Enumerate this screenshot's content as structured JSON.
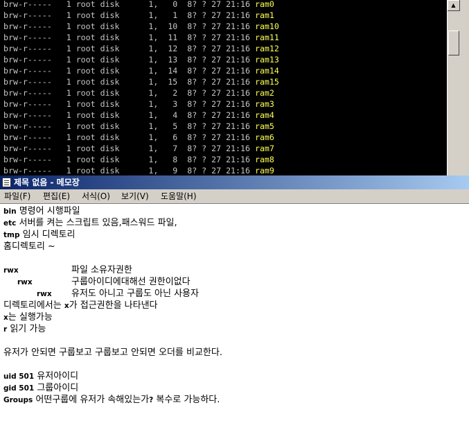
{
  "terminal": {
    "lines": [
      {
        "text": "brw-r-----   1 root disk      1,   0  8? ? 27 21:16 ",
        "file": "ram0"
      },
      {
        "text": "brw-r-----   1 root disk      1,   1  8? ? 27 21:16 ",
        "file": "ram1"
      },
      {
        "text": "brw-r-----   1 root disk      1,  10  8? ? 27 21:16 ",
        "file": "ram10"
      },
      {
        "text": "brw-r-----   1 root disk      1,  11  8? ? 27 21:16 ",
        "file": "ram11"
      },
      {
        "text": "brw-r-----   1 root disk      1,  12  8? ? 27 21:16 ",
        "file": "ram12"
      },
      {
        "text": "brw-r-----   1 root disk      1,  13  8? ? 27 21:16 ",
        "file": "ram13"
      },
      {
        "text": "brw-r-----   1 root disk      1,  14  8? ? 27 21:16 ",
        "file": "ram14"
      },
      {
        "text": "brw-r-----   1 root disk      1,  15  8? ? 27 21:16 ",
        "file": "ram15"
      },
      {
        "text": "brw-r-----   1 root disk      1,   2  8? ? 27 21:16 ",
        "file": "ram2"
      },
      {
        "text": "brw-r-----   1 root disk      1,   3  8? ? 27 21:16 ",
        "file": "ram3"
      },
      {
        "text": "brw-r-----   1 root disk      1,   4  8? ? 27 21:16 ",
        "file": "ram4"
      },
      {
        "text": "brw-r-----   1 root disk      1,   5  8? ? 27 21:16 ",
        "file": "ram5"
      },
      {
        "text": "brw-r-----   1 root disk      1,   6  8? ? 27 21:16 ",
        "file": "ram6"
      },
      {
        "text": "brw-r-----   1 root disk      1,   7  8? ? 27 21:16 ",
        "file": "ram7"
      },
      {
        "text": "brw-r-----   1 root disk      1,   8  8? ? 27 21:16 ",
        "file": "ram8"
      },
      {
        "text": "brw-r-----   1 root disk      1,   9  8? ? 27 21:16 ",
        "file": "ram9"
      }
    ]
  },
  "notepad": {
    "title": "제목 없음 - 메모장",
    "menu": [
      "파일(F)",
      "편집(E)",
      "서식(O)",
      "보기(V)",
      "도움말(H)"
    ],
    "lines": {
      "l1_key": "bin",
      "l1_text": " 명령어 시행파일",
      "l2_key": "etc",
      "l2_text": " 서버를 켜는 스크립트 있음,패스워드 파일,",
      "l3_key": "tmp",
      "l3_text": " 임시 디렉토리",
      "l4_text": "홈디렉토리 ~",
      "rwx1_key": "rwx",
      "rwx1_text": "파일 소유자권한",
      "rwx2_key": "rwx",
      "rwx2_text": "구룹아이디에대해선 권한이없다",
      "rwx3_key": "rwx",
      "rwx3_text": "유저도 아니고 구룹도 아닌 사용자",
      "l8_pre": "디렉토리에서는 ",
      "l8_key": "x",
      "l8_post": "가 접근권한을 나타낸다",
      "l9_key": "x",
      "l9_text": "는 실행가능",
      "l10_key": "r",
      "l10_text": " 읽기 가능",
      "l11_text": "유저가 안되면 구룹보고 구룹보고 안되면 오더를 비교한다.",
      "l12_key": "uid 501",
      "l12_text": " 유저아이디",
      "l13_key": "gid 501",
      "l13_text": " 그룹아이디",
      "l14_key": "Groups",
      "l14_text": " 어떤구룹에 유저가 속해있는가",
      "l14_q": "?",
      "l14_post": " 복수로 가능하다."
    }
  }
}
